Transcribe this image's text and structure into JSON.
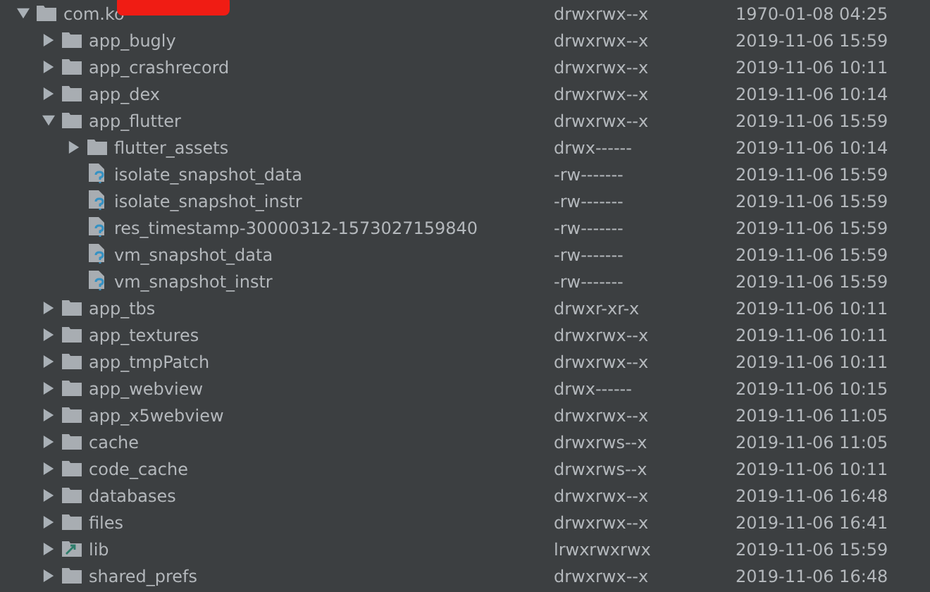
{
  "tree": [
    {
      "kind": "folder",
      "name": "com.ko",
      "redacted": true,
      "permissions": "drwxrwx--x",
      "date": "1970-01-08 04:25",
      "expanded": true,
      "children": [
        {
          "kind": "folder",
          "name": "app_bugly",
          "permissions": "drwxrwx--x",
          "date": "2019-11-06 15:59",
          "expanded": false
        },
        {
          "kind": "folder",
          "name": "app_crashrecord",
          "permissions": "drwxrwx--x",
          "date": "2019-11-06 10:11",
          "expanded": false
        },
        {
          "kind": "folder",
          "name": "app_dex",
          "permissions": "drwxrwx--x",
          "date": "2019-11-06 10:14",
          "expanded": false
        },
        {
          "kind": "folder",
          "name": "app_flutter",
          "permissions": "drwxrwx--x",
          "date": "2019-11-06 15:59",
          "expanded": true,
          "children": [
            {
              "kind": "folder",
              "name": "flutter_assets",
              "permissions": "drwx------",
              "date": "2019-11-06 10:14",
              "expanded": false
            },
            {
              "kind": "file",
              "name": "isolate_snapshot_data",
              "permissions": "-rw-------",
              "date": "2019-11-06 15:59"
            },
            {
              "kind": "file",
              "name": "isolate_snapshot_instr",
              "permissions": "-rw-------",
              "date": "2019-11-06 15:59"
            },
            {
              "kind": "file",
              "name": "res_timestamp-30000312-1573027159840",
              "permissions": "-rw-------",
              "date": "2019-11-06 15:59"
            },
            {
              "kind": "file",
              "name": "vm_snapshot_data",
              "permissions": "-rw-------",
              "date": "2019-11-06 15:59"
            },
            {
              "kind": "file",
              "name": "vm_snapshot_instr",
              "permissions": "-rw-------",
              "date": "2019-11-06 15:59"
            }
          ]
        },
        {
          "kind": "folder",
          "name": "app_tbs",
          "permissions": "drwxr-xr-x",
          "date": "2019-11-06 10:11",
          "expanded": false
        },
        {
          "kind": "folder",
          "name": "app_textures",
          "permissions": "drwxrwx--x",
          "date": "2019-11-06 10:11",
          "expanded": false
        },
        {
          "kind": "folder",
          "name": "app_tmpPatch",
          "permissions": "drwxrwx--x",
          "date": "2019-11-06 10:11",
          "expanded": false
        },
        {
          "kind": "folder",
          "name": "app_webview",
          "permissions": "drwx------",
          "date": "2019-11-06 10:15",
          "expanded": false
        },
        {
          "kind": "folder",
          "name": "app_x5webview",
          "permissions": "drwxrwx--x",
          "date": "2019-11-06 11:05",
          "expanded": false
        },
        {
          "kind": "folder",
          "name": "cache",
          "permissions": "drwxrws--x",
          "date": "2019-11-06 11:05",
          "expanded": false
        },
        {
          "kind": "folder",
          "name": "code_cache",
          "permissions": "drwxrws--x",
          "date": "2019-11-06 10:11",
          "expanded": false
        },
        {
          "kind": "folder",
          "name": "databases",
          "permissions": "drwxrwx--x",
          "date": "2019-11-06 16:48",
          "expanded": false
        },
        {
          "kind": "folder",
          "name": "files",
          "permissions": "drwxrwx--x",
          "date": "2019-11-06 16:41",
          "expanded": false
        },
        {
          "kind": "link",
          "name": "lib",
          "permissions": "lrwxrwxrwx",
          "date": "2019-11-06 15:59",
          "expanded": false
        },
        {
          "kind": "folder",
          "name": "shared_prefs",
          "permissions": "drwxrwx--x",
          "date": "2019-11-06 16:48",
          "expanded": false
        }
      ]
    }
  ]
}
